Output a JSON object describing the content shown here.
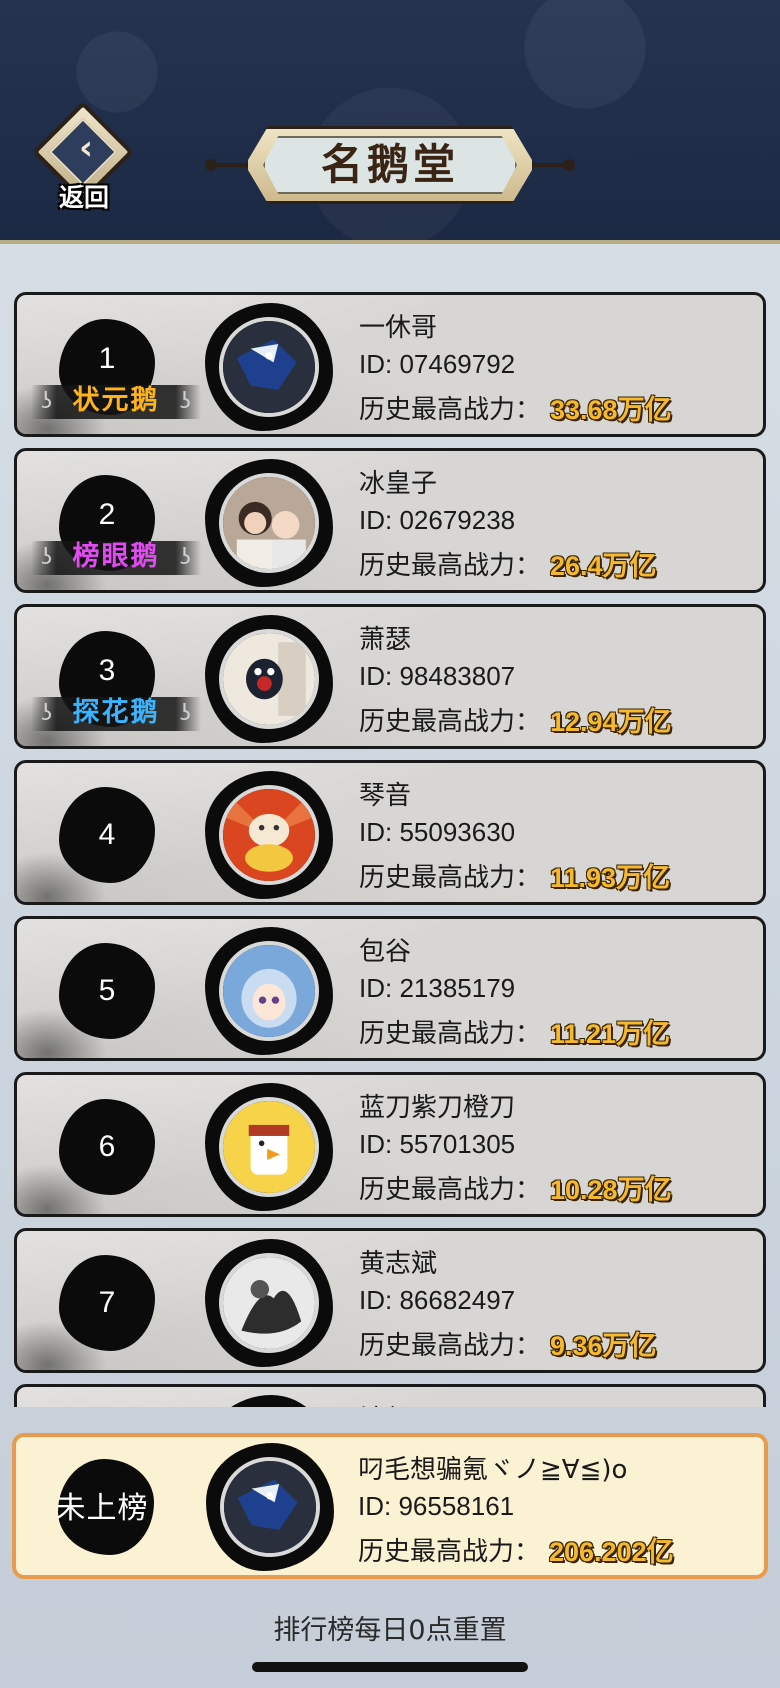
{
  "header": {
    "back_label": "返回",
    "title": "名鹅堂"
  },
  "ranks": [
    {
      "rank": "1",
      "title": "状元鹅",
      "title_color": "#ffb31a",
      "name": "一休哥",
      "id": "ID: 07469792",
      "power_label": "历史最高战力：",
      "power": "33.68万亿",
      "avatar": "blue-bird-avatar"
    },
    {
      "rank": "2",
      "title": "榜眼鹅",
      "title_color": "#e04cf0",
      "name": "冰皇子",
      "id": "ID: 02679238",
      "power_label": "历史最高战力：",
      "power": "26.4万亿",
      "avatar": "family-photo-avatar"
    },
    {
      "rank": "3",
      "title": "探花鹅",
      "title_color": "#3ab4ff",
      "name": "萧瑟",
      "id": "ID: 98483807",
      "power_label": "历史最高战力：",
      "power": "12.94万亿",
      "avatar": "cartoon-cat-avatar"
    },
    {
      "rank": "4",
      "name": "琴音",
      "id": "ID: 55093630",
      "power_label": "历史最高战力：",
      "power": "11.93万亿",
      "avatar": "lucky-cat-avatar"
    },
    {
      "rank": "5",
      "name": "包谷",
      "id": "ID: 21385179",
      "power_label": "历史最高战力：",
      "power": "11.21万亿",
      "avatar": "anime-girl-avatar"
    },
    {
      "rank": "6",
      "name": "蓝刀紫刀橙刀",
      "id": "ID: 55701305",
      "power_label": "历史最高战力：",
      "power": "10.28万亿",
      "avatar": "duck-cartoon-avatar"
    },
    {
      "rank": "7",
      "name": "黄志斌",
      "id": "ID: 86682497",
      "power_label": "历史最高战力：",
      "power": "9.36万亿",
      "avatar": "ink-painting-avatar"
    },
    {
      "rank": "",
      "name": "禧仔",
      "id": "",
      "power_label": "",
      "power": "",
      "avatar": "partial-avatar"
    }
  ],
  "me": {
    "rank": "未上榜",
    "name": "叼毛想骗氪ヾノ≧∀≦)o",
    "id": "ID: 96558161",
    "power_label": "历史最高战力：",
    "power": "206.202亿",
    "avatar": "blue-bird-avatar"
  },
  "footer": "排行榜每日0点重置"
}
